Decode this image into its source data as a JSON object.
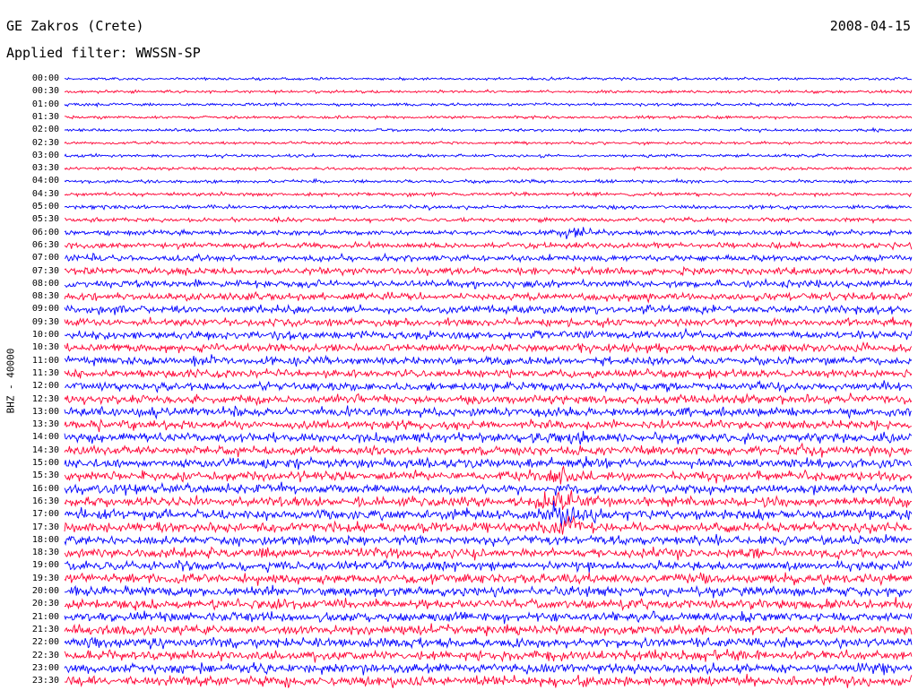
{
  "header": {
    "station": "GE Zakros (Crete)",
    "date": "2008-04-15",
    "filter": "Applied filter: WWSSN-SP"
  },
  "chart_data": {
    "type": "line",
    "title": "GE Zakros (Crete)",
    "subtitle": "Applied filter: WWSSN-SP",
    "ylabel": "BHZ - 40000",
    "xlabel": "",
    "grid": false,
    "colors": {
      "trace_a": "#0000ff",
      "trace_b": "#ff0033",
      "background": "#ffffff"
    },
    "hours": [
      "00:00",
      "00:30",
      "01:00",
      "01:30",
      "02:00",
      "02:30",
      "03:00",
      "03:30",
      "04:00",
      "04:30",
      "05:00",
      "05:30",
      "06:00",
      "06:30",
      "07:00",
      "07:30",
      "08:00",
      "08:30",
      "09:00",
      "09:30",
      "10:00",
      "10:30",
      "11:00",
      "11:30",
      "12:00",
      "12:30",
      "13:00",
      "13:30",
      "14:00",
      "14:30",
      "15:00",
      "15:30",
      "16:00",
      "16:30",
      "17:00",
      "17:30",
      "18:00",
      "18:30",
      "19:00",
      "19:30",
      "20:00",
      "20:30",
      "21:00",
      "21:30",
      "22:00",
      "22:30",
      "23:00",
      "23:30"
    ],
    "trace_amplitude_level": [
      0.35,
      0.35,
      0.35,
      0.35,
      0.35,
      0.35,
      0.38,
      0.38,
      0.4,
      0.42,
      0.45,
      0.5,
      0.6,
      0.7,
      0.8,
      0.85,
      0.9,
      0.9,
      0.95,
      0.95,
      1.0,
      1.0,
      1.0,
      1.0,
      1.05,
      1.05,
      1.1,
      1.1,
      1.1,
      1.1,
      1.1,
      1.1,
      1.15,
      1.15,
      1.15,
      1.15,
      1.15,
      1.15,
      1.15,
      1.15,
      1.15,
      1.15,
      1.15,
      1.15,
      1.15,
      1.15,
      1.2,
      1.2
    ],
    "events": [
      {
        "hour": "06:00",
        "position_fraction": 0.61,
        "level": 2.2
      },
      {
        "hour": "14:00",
        "position_fraction": 0.585,
        "level": 1.6
      },
      {
        "hour": "15:30",
        "position_fraction": 0.59,
        "level": 2.2
      },
      {
        "hour": "16:30",
        "position_fraction": 0.59,
        "level": 3.2
      },
      {
        "hour": "17:00",
        "position_fraction": 0.59,
        "level": 3.0
      },
      {
        "hour": "17:30",
        "position_fraction": 0.595,
        "level": 2.6
      }
    ]
  }
}
